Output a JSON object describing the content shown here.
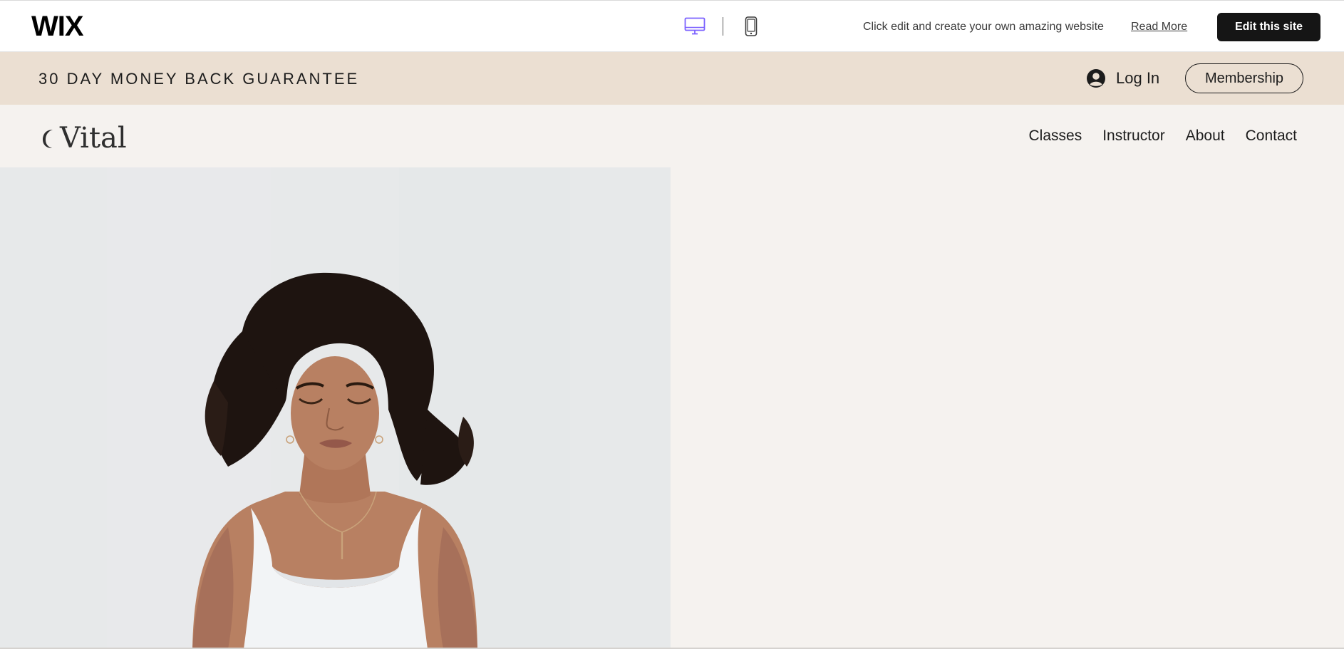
{
  "wix_bar": {
    "logo": "WIX",
    "message": "Click edit and create your own amazing website",
    "read_more": "Read More",
    "edit_button": "Edit this site",
    "device_icons": [
      "desktop-icon",
      "mobile-icon"
    ],
    "accent_color": "#7b61ff"
  },
  "promo": {
    "text": "30 DAY MONEY BACK GUARANTEE",
    "login_label": "Log In",
    "membership_label": "Membership",
    "background": "#ebdfd2"
  },
  "header": {
    "brand": "Vital",
    "nav": [
      "Classes",
      "Instructor",
      "About",
      "Contact"
    ]
  },
  "hero": {
    "image_subject": "woman meditating with eyes closed",
    "right_panel_color": "#f5f2ef"
  }
}
